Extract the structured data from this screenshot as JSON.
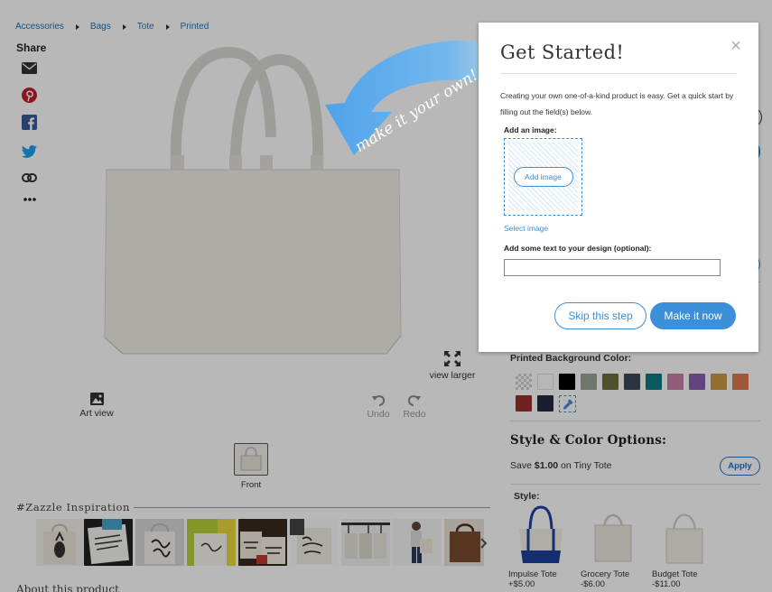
{
  "breadcrumb": [
    "Accessories",
    "Bags",
    "Tote",
    "Printed"
  ],
  "share": {
    "title": "Share",
    "icons": [
      "email-icon",
      "pinterest-icon",
      "facebook-icon",
      "twitter-icon",
      "link-icon",
      "more-icon"
    ]
  },
  "tools": {
    "art_view": "Art view",
    "view_larger": "view larger",
    "undo": "Undo",
    "redo": "Redo"
  },
  "views": {
    "front": "Front"
  },
  "inspiration": {
    "title": "#Zazzle Inspiration",
    "thumbs": [
      "pineapple-tote",
      "quote-tote",
      "girl-boss-tote",
      "wifey-tote",
      "market-totes",
      "best-weekend-ever-tote",
      "hanging-totes",
      "woman-with-tote",
      "leather-tote"
    ]
  },
  "about": "About this product",
  "right": {
    "background_label": "Printed Background Color:",
    "swatches": [
      "#d7d7d7",
      "#ffffff",
      "#000000",
      "#9aa596",
      "#6e6f3e",
      "#3c4a58",
      "#0d7b86",
      "#c77fa6",
      "#8a5fb3",
      "#c99a45",
      "#e07b4e",
      "#9b3030",
      "#232a45"
    ],
    "style_heading": "Style & Color Options:",
    "save_prefix": "Save ",
    "save_amount": "$1.00",
    "save_suffix": " on Tiny Tote",
    "apply": "Apply",
    "style_label": "Style:",
    "styles": [
      {
        "name": "Impulse Tote",
        "price": "+$5.00"
      },
      {
        "name": "Grocery Tote",
        "price": "-$6.00"
      },
      {
        "name": "Budget Tote",
        "price": "-$11.00"
      }
    ]
  },
  "promo": {
    "text": "make it your own!"
  },
  "modal": {
    "title": "Get Started!",
    "close": "×",
    "description": "Creating your own one-of-a-kind product is easy. Get a quick start by filling out the field(s) below.",
    "add_image_label": "Add an image:",
    "add_image_button": "Add image",
    "select_image": "Select image",
    "text_label": "Add some text to your design (optional):",
    "text_value": "",
    "skip": "Skip this step",
    "make": "Make it now"
  },
  "colors": {
    "accent": "#3c8fd8",
    "link": "#1e73be",
    "promo_arrow": "#6aaee8"
  }
}
